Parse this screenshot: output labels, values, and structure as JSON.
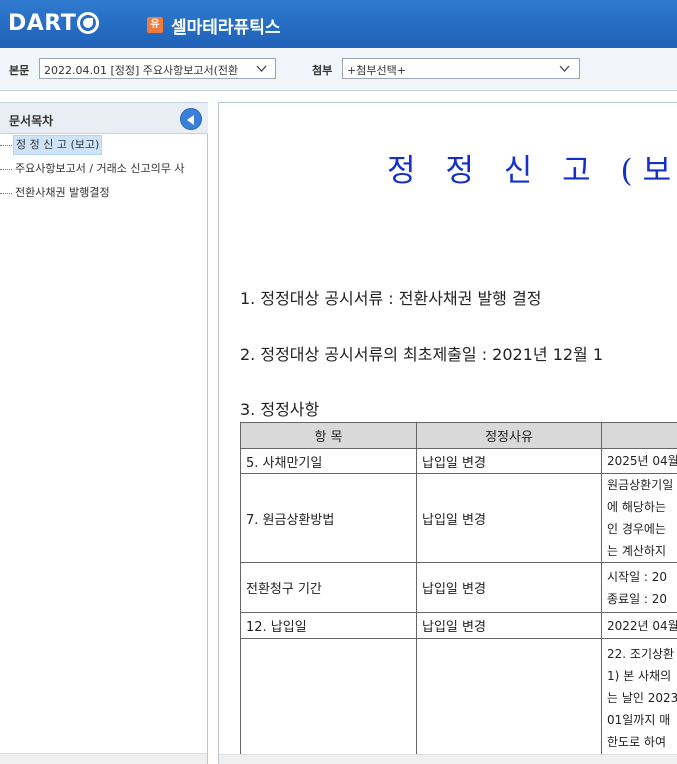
{
  "header": {
    "logo_text": "DART",
    "company_badge": "유",
    "company_name": "셀마테라퓨틱스"
  },
  "toolbar": {
    "main_label": "본문",
    "main_select_value": "2022.04.01  [정정] 주요사항보고서(전환",
    "attach_label": "첨부",
    "attach_select_value": "+첨부선택+"
  },
  "sidebar": {
    "title": "문서목차",
    "items": [
      {
        "label": "정 정 신 고 (보고)"
      },
      {
        "label": "주요사항보고서 / 거래소 신고의무 사"
      },
      {
        "label": "전환사채권 발행결정"
      }
    ]
  },
  "document": {
    "title": "정 정 신 고 (보고",
    "line1": "1. 정정대상 공시서류 : 전환사채권 발행 결정",
    "line2": "2. 정정대상 공시서류의 최초제출일 : 2021년 12월 1",
    "line3": "3. 정정사항",
    "table": {
      "headers": [
        "항  목",
        "정정사유",
        ""
      ],
      "rows": [
        {
          "item": "5. 사채만기일",
          "reason": "납입일 변경",
          "detail": [
            "2025년 04월"
          ]
        },
        {
          "item": "7. 원금상환방법",
          "reason": "납입일 변경",
          "detail": [
            "원금상환기일",
            "에 해당하는",
            "인 경우에는",
            "는 계산하지"
          ]
        },
        {
          "item": "전환청구 기간",
          "reason": "납입일 변경",
          "detail": [
            "시작일 : 20",
            "종료일 : 20"
          ]
        },
        {
          "item": "12. 납입일",
          "reason": "납입일 변경",
          "detail": [
            "2022년 04월"
          ]
        },
        {
          "item": "",
          "reason": "",
          "detail": [
            "22. 조기상환",
            "1) 본 사채의",
            "는 날인 2023",
            "01일까지 매",
            "한도로 하여"
          ]
        }
      ]
    }
  }
}
